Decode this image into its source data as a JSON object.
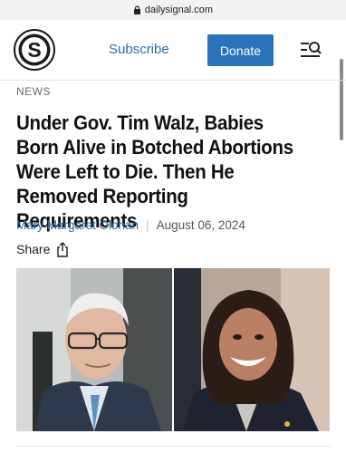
{
  "browser": {
    "url": "dailysignal.com"
  },
  "header": {
    "logo_letter": "S",
    "subscribe_label": "Subscribe",
    "donate_label": "Donate"
  },
  "article": {
    "section": "NEWS",
    "headline": "Under Gov. Tim Walz, Babies Born Alive in Botched Abortions Were Left to Die. Then He Removed Reporting Requirements",
    "author": "Mary Margaret Olohan",
    "separator": "|",
    "date": "August 06, 2024",
    "share_label": "Share"
  },
  "colors": {
    "link": "#2a6fa8",
    "donate_bg": "#2b73b9",
    "text": "#111111",
    "muted": "#6b6b6b"
  },
  "icons": [
    "lock-icon",
    "menu-search-icon",
    "share-icon"
  ]
}
